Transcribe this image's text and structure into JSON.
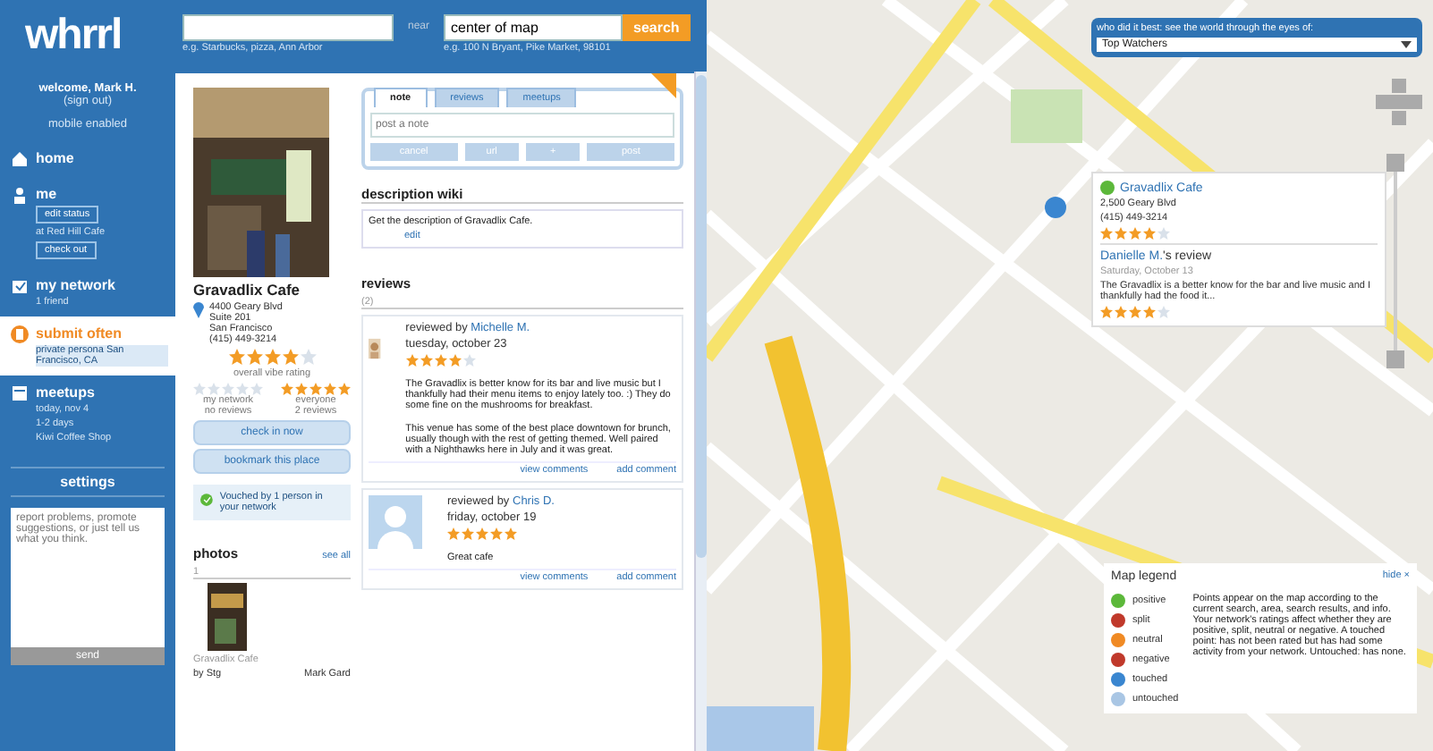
{
  "header": {
    "logo": "whrrl",
    "what_field": {
      "hint": "e.g. Starbucks, pizza, Ann Arbor"
    },
    "separator": "near",
    "where_field": {
      "value": "center of map",
      "hint": "e.g. 100 N Bryant, Pike Market, 98101"
    },
    "search_button": "search"
  },
  "sidebar": {
    "welcome": "welcome, Mark H.",
    "sign_out": "(sign out)",
    "mobile": "mobile enabled",
    "items": [
      {
        "kind": "home",
        "label": "home",
        "selected": false
      },
      {
        "kind": "me",
        "label": "me",
        "selected": false,
        "buttons": [
          "edit status",
          "check out"
        ],
        "status": "at Red Hill Cafe"
      },
      {
        "kind": "network",
        "label": "my network",
        "selected": false,
        "lines": [
          "1 friend"
        ]
      },
      {
        "kind": "persona",
        "label": "submit often",
        "selected": true,
        "lines": [
          "private persona San Francisco, CA"
        ]
      },
      {
        "kind": "meetups",
        "label": "meetups",
        "selected": false,
        "lines": [
          "today, nov 4",
          "1-2 days",
          "Kiwi Coffee Shop"
        ]
      }
    ],
    "settings": "settings",
    "feedback": {
      "placeholder": "report problems, promote suggestions, or just tell us what you think."
    },
    "send": "send"
  },
  "place": {
    "name": "Gravadlix Cafe",
    "address": [
      "4400 Geary Blvd",
      "Suite 201",
      "San Francisco",
      "(415) 449-3214"
    ],
    "overall": {
      "stars": 4,
      "label": "overall vibe rating"
    },
    "network": {
      "stars": 0,
      "label": "my network",
      "count": "no reviews"
    },
    "everyone": {
      "stars": 5,
      "label": "everyone",
      "count": "2 reviews"
    },
    "actions": [
      "check in now",
      "bookmark this place"
    ],
    "vouched": "Vouched by 1 person in your network",
    "photos": {
      "title": "photos",
      "count": "1",
      "see_all": "see all",
      "caption": "Gravadlix Cafe",
      "by": [
        "by Stg",
        "Mark Gard"
      ]
    }
  },
  "tabs": [
    {
      "label": "note",
      "selected": true
    },
    {
      "label": "reviews",
      "selected": false
    },
    {
      "label": "meetups",
      "selected": false
    }
  ],
  "note": {
    "placeholder": "post a note",
    "buttons": [
      "cancel",
      "url",
      "+",
      "post"
    ]
  },
  "description": {
    "title": "description wiki",
    "text": "Get the description of Gravadlix Cafe.",
    "edit": "edit"
  },
  "reviews": {
    "title": "reviews",
    "count": "(2)",
    "items": [
      {
        "by": "reviewed by",
        "author": "Michelle M.",
        "date": "tuesday, october 23",
        "stars": 4,
        "paragraphs": [
          "The Gravadlix is better know for its bar and live music but I thankfully had their menu items to enjoy lately too. :) They do some fine on the mushrooms for breakfast.",
          "This venue has some of the best place downtown for brunch, usually though with the rest of getting themed. Well paired with a Nighthawks here in July and it was great."
        ],
        "links": [
          "view comments",
          "add comment"
        ]
      },
      {
        "kind": "avatar",
        "by": "reviewed by",
        "author": "Chris D.",
        "date": "friday, october 19",
        "stars": 5,
        "paragraphs": [
          "Great cafe"
        ],
        "links": [
          "view comments",
          "add comment"
        ]
      }
    ]
  },
  "map": {
    "watch": {
      "title": "who did it best: see the world through the eyes of:",
      "value": "Top Watchers"
    },
    "popup": {
      "name": "Gravadlix Cafe",
      "address": "2,500 Geary Blvd",
      "phone": "(415) 449-3214",
      "stars": 4,
      "review": {
        "author": "Danielle M.",
        "suffix": "'s review",
        "date": "Saturday, October 13",
        "text": "The Gravadlix is a better know for the bar and live music and I thankfully had the food it...",
        "stars": 4
      }
    },
    "legend": {
      "title": "Map legend",
      "hide": "hide ×",
      "items": [
        {
          "label": "positive",
          "color": "#5cb83a"
        },
        {
          "label": "split",
          "color": "#c0392b"
        },
        {
          "label": "neutral",
          "color": "#f08a24"
        },
        {
          "label": "negative",
          "color": "#c0392b"
        },
        {
          "label": "touched",
          "color": "#3a86d0"
        },
        {
          "label": "untouched",
          "color": "#a9c6e4"
        }
      ],
      "text": "Points appear on the map according to the current search, area, search results, and info. Your network's ratings affect whether they are positive, split, neutral or negative. A touched point: has not been rated but has had some activity from your network. Untouched: has none."
    }
  }
}
